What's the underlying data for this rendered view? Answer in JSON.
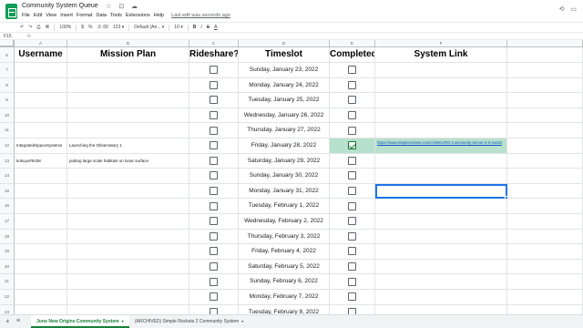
{
  "app": {
    "title": "Community System Queue",
    "title_icons": "☆ ⊡ ☁",
    "menu": [
      "File",
      "Edit",
      "View",
      "Insert",
      "Format",
      "Data",
      "Tools",
      "Extensions",
      "Help"
    ],
    "last_edit": "Last edit was seconds ago"
  },
  "toolbar": {
    "zoom": "100%",
    "currency": "$",
    "percent": "%",
    "decimals": ".0 .00",
    "number_format": "123 ▾",
    "font": "Default (Ari... ▾",
    "font_size": "10 ▾",
    "bold": "B",
    "italic": "I",
    "strike": "S",
    "text_color": "A"
  },
  "formula": {
    "name_box": "F15",
    "fx": "fx"
  },
  "columns": [
    "A",
    "B",
    "C",
    "D",
    "E",
    "F"
  ],
  "headers": {
    "username": "Username",
    "mission_plan": "Mission Plan",
    "rideshare": "Rideshare?",
    "timeslot": "Timeslot",
    "completed": "Completed?",
    "system_link": "System Link"
  },
  "rows": [
    {
      "num": "7",
      "username": "",
      "mission": "",
      "timeslot": "Sunday, January 23, 2022",
      "completed": false,
      "link": ""
    },
    {
      "num": "8",
      "username": "",
      "mission": "",
      "timeslot": "Monday, January 24, 2022",
      "completed": false,
      "link": ""
    },
    {
      "num": "9",
      "username": "",
      "mission": "",
      "timeslot": "Tuesday, January 25, 2022",
      "completed": false,
      "link": ""
    },
    {
      "num": "10",
      "username": "",
      "mission": "",
      "timeslot": "Wednesday, January 26, 2022",
      "completed": false,
      "link": ""
    },
    {
      "num": "11",
      "username": "",
      "mission": "",
      "timeslot": "Thursday, January 27, 2022",
      "completed": false,
      "link": ""
    },
    {
      "num": "12",
      "username": "IntegratedSpaceSystems",
      "mission": "Launching the Observatory 1",
      "timeslot": "Friday, January 28, 2022",
      "completed": true,
      "link": "https://www.simplerockets.com/c/o08cc/RO-Community-Server-2-0-Jan28"
    },
    {
      "num": "13",
      "username": "kokuyu#5438",
      "mission": "putting large scale habitats on lunar surface",
      "timeslot": "Saturday, January 29, 2022",
      "completed": false,
      "link": ""
    },
    {
      "num": "14",
      "username": "",
      "mission": "",
      "timeslot": "Sunday, January 30, 2022",
      "completed": false,
      "link": ""
    },
    {
      "num": "15",
      "username": "",
      "mission": "",
      "timeslot": "Monday, January 31, 2022",
      "completed": false,
      "link": ""
    },
    {
      "num": "16",
      "username": "",
      "mission": "",
      "timeslot": "Tuesday, February 1, 2022",
      "completed": false,
      "link": ""
    },
    {
      "num": "17",
      "username": "",
      "mission": "",
      "timeslot": "Wednesday, February 2, 2022",
      "completed": false,
      "link": ""
    },
    {
      "num": "18",
      "username": "",
      "mission": "",
      "timeslot": "Thursday, February 3, 2022",
      "completed": false,
      "link": ""
    },
    {
      "num": "19",
      "username": "",
      "mission": "",
      "timeslot": "Friday, February 4, 2022",
      "completed": false,
      "link": ""
    },
    {
      "num": "20",
      "username": "",
      "mission": "",
      "timeslot": "Saturday, February 5, 2022",
      "completed": false,
      "link": ""
    },
    {
      "num": "21",
      "username": "",
      "mission": "",
      "timeslot": "Sunday, February 6, 2022",
      "completed": false,
      "link": ""
    },
    {
      "num": "22",
      "username": "",
      "mission": "",
      "timeslot": "Monday, February 7, 2022",
      "completed": false,
      "link": ""
    },
    {
      "num": "23",
      "username": "",
      "mission": "",
      "timeslot": "Tuesday, February 8, 2022",
      "completed": false,
      "link": ""
    }
  ],
  "tabs": {
    "add": "+",
    "all": "≡",
    "items": [
      {
        "label": "Juno New Origins Community System",
        "active": true
      },
      {
        "label": "(ARCHIVED) Simple Rockets 2 Community System",
        "active": false
      }
    ],
    "caret": "▾"
  },
  "colors": {
    "sheets_green": "#0f9d58",
    "checked_fill": "#b7e1cd",
    "selection_blue": "#1a73e8",
    "link_blue": "#1155cc"
  },
  "icons": [
    "sheets-logo-icon",
    "star-icon",
    "move-icon",
    "cloud-icon",
    "history-icon",
    "comment-icon",
    "meet-icon",
    "share-icon"
  ]
}
